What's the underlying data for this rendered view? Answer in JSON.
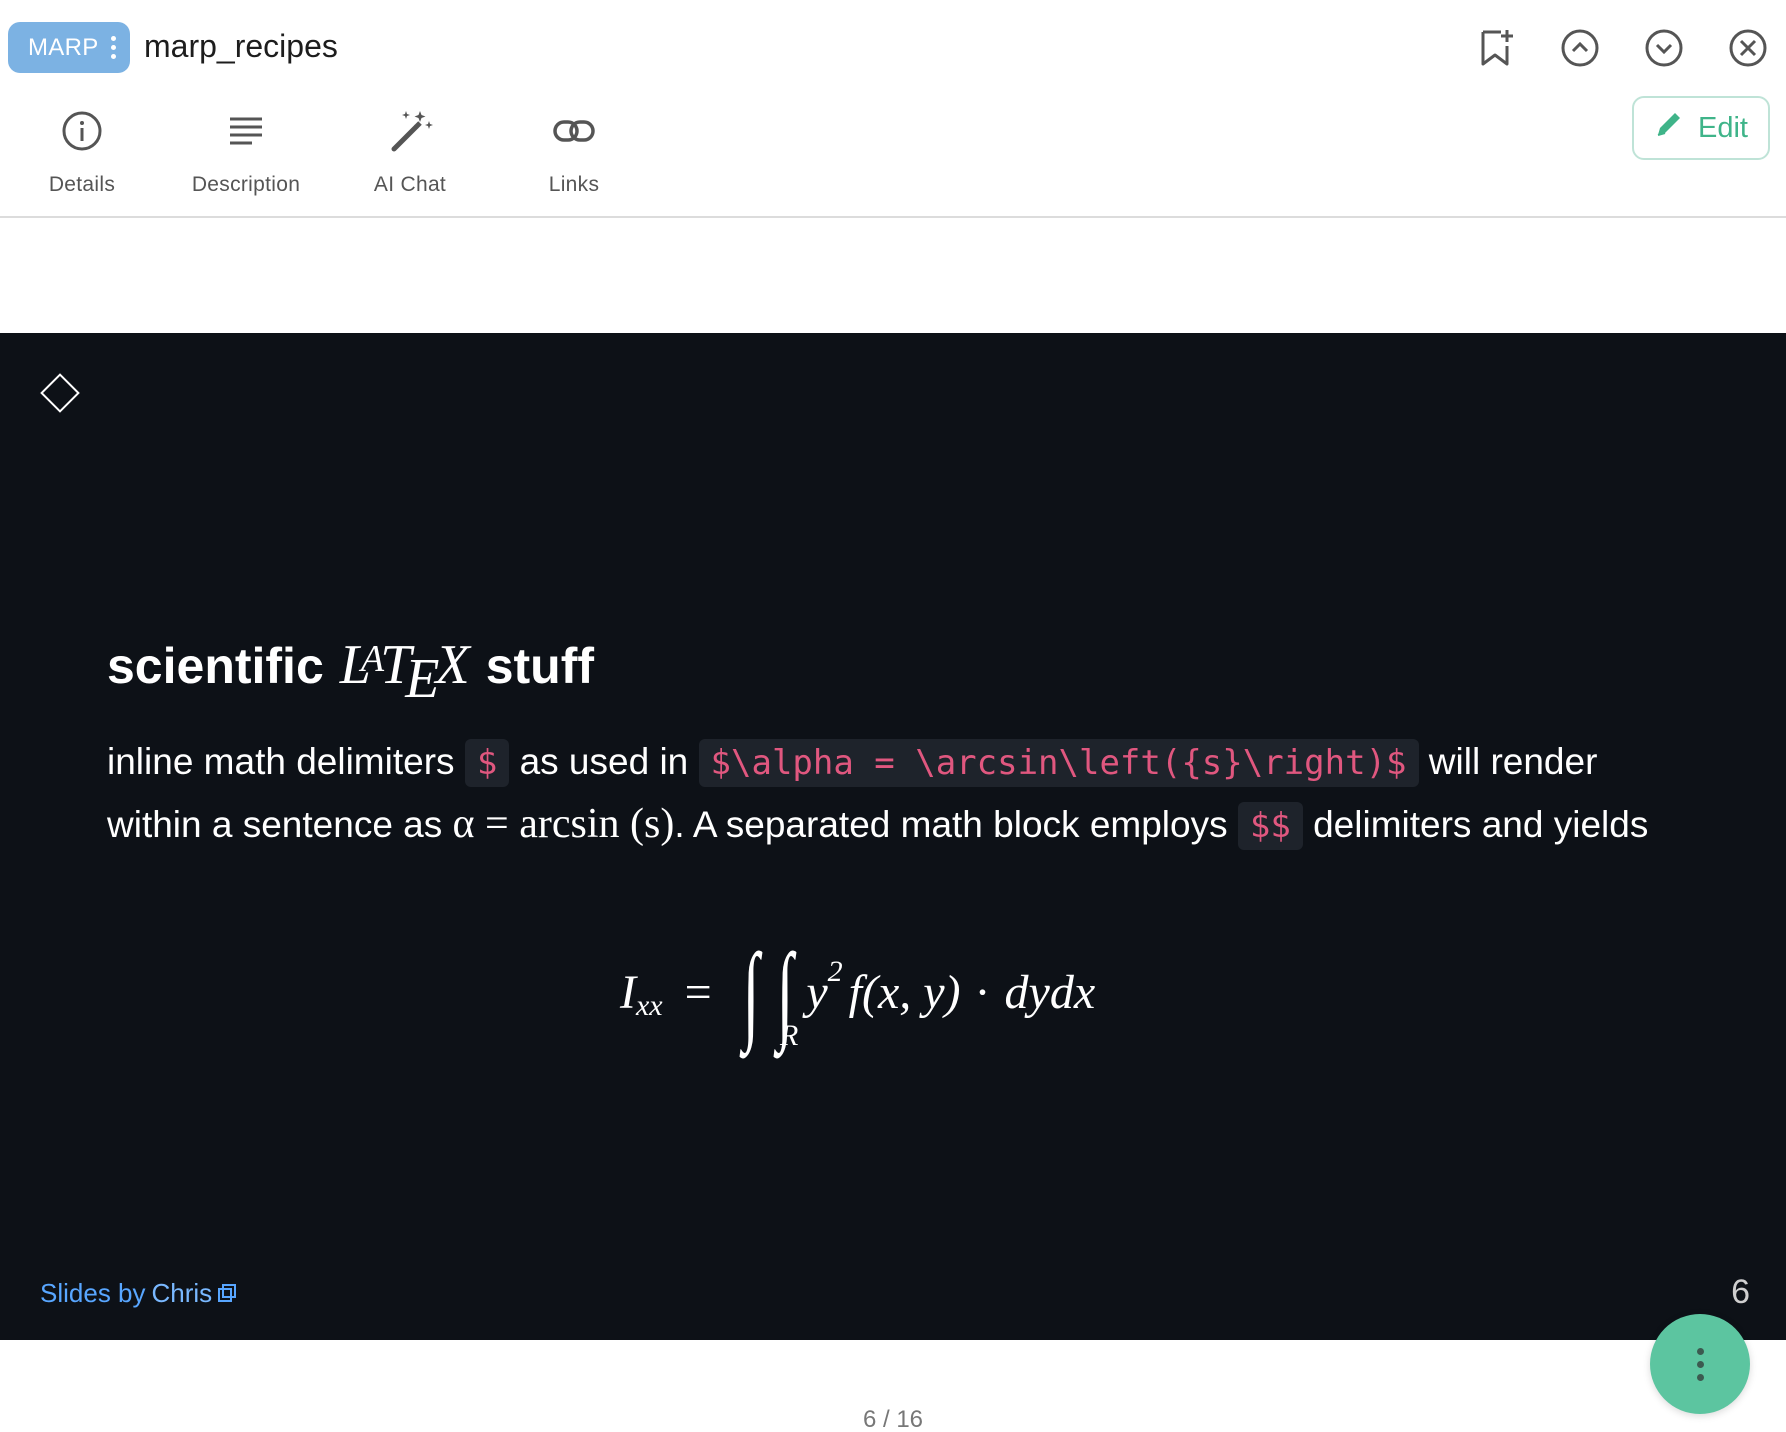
{
  "header": {
    "tag": "MARP",
    "title": "marp_recipes",
    "icons": [
      "bookmark-add-icon",
      "chevron-up-circle-icon",
      "chevron-down-circle-icon",
      "close-circle-icon"
    ]
  },
  "tabs": [
    {
      "label": "Details",
      "icon": "info-icon"
    },
    {
      "label": "Description",
      "icon": "description-lines-icon"
    },
    {
      "label": "AI Chat",
      "icon": "magic-wand-icon"
    },
    {
      "label": "Links",
      "icon": "link-icon"
    }
  ],
  "edit_button": {
    "label": "Edit",
    "icon": "pencil-icon"
  },
  "slide": {
    "heading_pre": "scientific",
    "heading_logo": {
      "l": "L",
      "a": "A",
      "t": "T",
      "e": "E",
      "x": "X"
    },
    "heading_post": "stuff",
    "body": {
      "t1": "inline math delimiters",
      "code1": "$",
      "t2": "as used in",
      "code2": "$\\alpha = \\arcsin\\left({s}\\right)$",
      "t3": "will render within a sentence as",
      "math_inline": "α = arcsin (s)",
      "t4": ". A separated math block employs",
      "code3": "$$",
      "t5": "delimiters and yields"
    },
    "math_block": {
      "lhs": "I",
      "lhs_sub": "xx",
      "eq": "=",
      "int1": "∫",
      "int2": "∫",
      "int_sub": "R",
      "y": "y",
      "y_sup": "2",
      "f": "f(x, y)",
      "dot": "·",
      "d": "dydx"
    },
    "footer_prefix": "Slides by",
    "footer_author": "Chris",
    "slide_number": "6"
  },
  "pager": "6 / 16",
  "colors": {
    "tag_bg": "#7cb2e3",
    "accent": "#3fb489",
    "slide_bg": "#0d1117",
    "code_text": "#e0577f",
    "link": "#58a6ff",
    "fab": "#5cc5a0"
  }
}
